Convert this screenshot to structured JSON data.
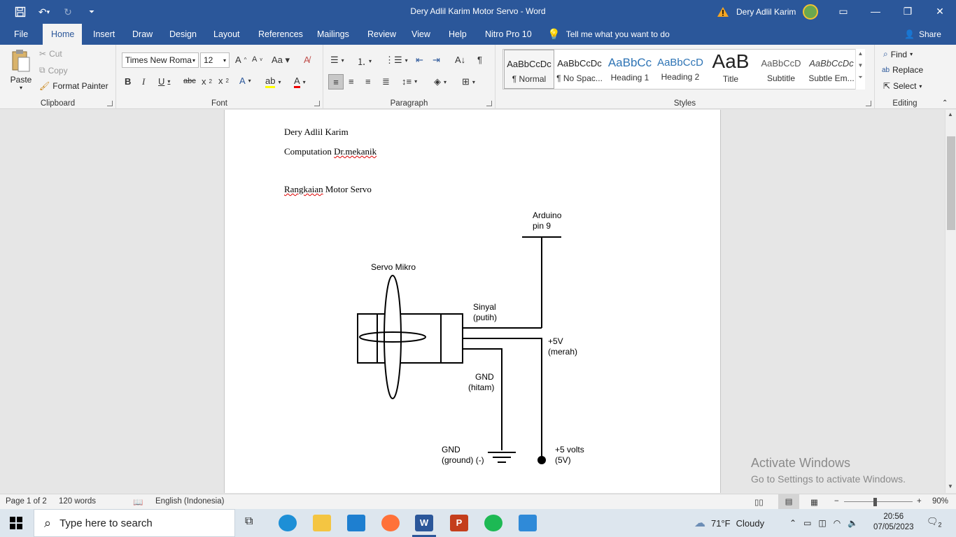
{
  "window": {
    "title": "Dery Adlil Karim Motor Servo  -  Word",
    "user": "Dery Adlil Karim"
  },
  "qat": {
    "save": "💾",
    "undo": "↶",
    "redo": "↻",
    "more": "⌄"
  },
  "tabs": [
    "File",
    "Home",
    "Insert",
    "Draw",
    "Design",
    "Layout",
    "References",
    "Mailings",
    "Review",
    "View",
    "Help",
    "Nitro Pro 10"
  ],
  "tell_me": "Tell me what you want to do",
  "share": "Share",
  "ribbon": {
    "clipboard": {
      "label": "Clipboard",
      "paste": "Paste",
      "cut": "Cut",
      "copy": "Copy",
      "format_painter": "Format Painter"
    },
    "font": {
      "label": "Font",
      "family": "Times New Roma",
      "size": "12"
    },
    "paragraph": {
      "label": "Paragraph"
    },
    "styles": {
      "label": "Styles",
      "items": [
        {
          "preview": "AaBbCcDc",
          "name": "¶ Normal",
          "color": "#000"
        },
        {
          "preview": "AaBbCcDc",
          "name": "¶ No Spac...",
          "color": "#000"
        },
        {
          "preview": "AaBbCc",
          "name": "Heading 1",
          "color": "#2e74b5"
        },
        {
          "preview": "AaBbCcD",
          "name": "Heading 2",
          "color": "#2e74b5"
        },
        {
          "preview": "AaB",
          "name": "Title",
          "color": "#000"
        },
        {
          "preview": "AaBbCcD",
          "name": "Subtitle",
          "color": "#595959"
        },
        {
          "preview": "AaBbCcDc",
          "name": "Subtle Em...",
          "color": "#404040"
        }
      ]
    },
    "editing": {
      "label": "Editing",
      "find": "Find",
      "replace": "Replace",
      "select": "Select"
    }
  },
  "document": {
    "line1": "Dery Adlil Karim",
    "line2a": "Computation ",
    "line2b": "Dr.mekanik",
    "line3a": "Rangkaian",
    "line3b": " Motor Servo"
  },
  "diagram": {
    "arduino": [
      "Arduino",
      "pin 9"
    ],
    "servo": "Servo Mikro",
    "sinyal": [
      "Sinyal",
      "(putih)"
    ],
    "plus5v": [
      "+5V",
      "(merah)"
    ],
    "gnd_wire": [
      "GND",
      "(hitam)"
    ],
    "gnd": [
      "GND",
      "(ground) (-)"
    ],
    "volts": [
      "+5 volts",
      "(5V)"
    ]
  },
  "watermark": {
    "line1": "Activate Windows",
    "line2": "Go to Settings to activate Windows."
  },
  "status": {
    "page": "Page 1 of 2",
    "words": "120 words",
    "language": "English (Indonesia)",
    "zoom": "90%"
  },
  "taskbar": {
    "search_placeholder": "Type here to search",
    "weather_temp": "71°F",
    "weather": "Cloudy",
    "time": "20:56",
    "date": "07/05/2023",
    "notifications": "2"
  }
}
